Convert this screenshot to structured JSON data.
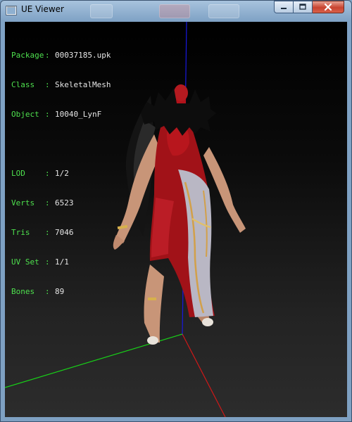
{
  "window": {
    "title": "UE Viewer"
  },
  "info": {
    "package": {
      "label": "Package",
      "value": "00037185.upk"
    },
    "class": {
      "label": "Class",
      "value": "SkeletalMesh"
    },
    "object": {
      "label": "Object",
      "value": "10040_LynF"
    },
    "lod": {
      "label": "LOD",
      "value": "1/2"
    },
    "verts": {
      "label": "Verts",
      "value": "6523"
    },
    "tris": {
      "label": "Tris",
      "value": "7046"
    },
    "uvset": {
      "label": "UV Set",
      "value": "1/1"
    },
    "bones": {
      "label": "Bones",
      "value": "89"
    },
    "separator": ":"
  },
  "colors": {
    "info_label": "#4ee04e",
    "info_value": "#e6e6e6",
    "axis_x": "#d01818",
    "axis_y": "#18d018",
    "axis_z": "#1818e0",
    "close_button": "#c8432f"
  },
  "icons": {
    "app": "app-icon",
    "minimize": "minimize-icon",
    "maximize": "maximize-icon",
    "close": "close-icon"
  }
}
